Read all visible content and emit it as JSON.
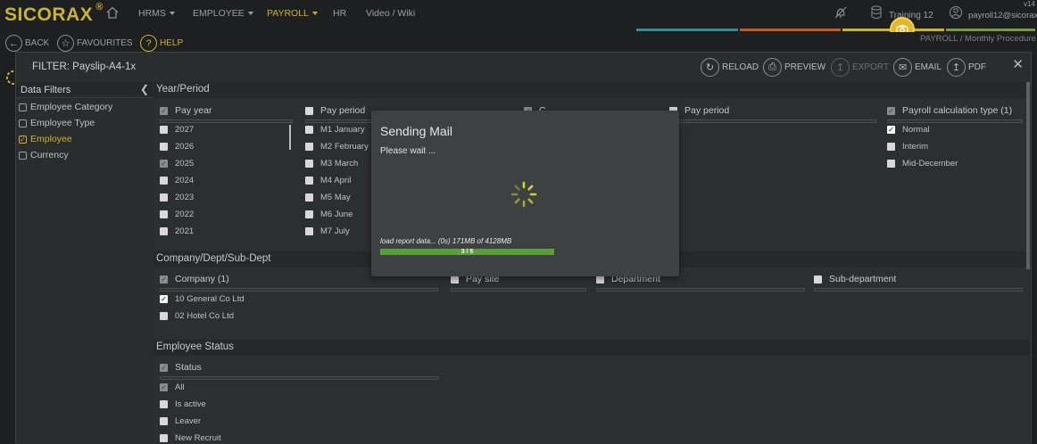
{
  "app": {
    "logo": "SICORAX",
    "logo_mark": "®",
    "version": "v14"
  },
  "topnav": {
    "items": [
      {
        "label": "HRMS",
        "dropdown": true
      },
      {
        "label": "EMPLOYEE",
        "dropdown": true
      },
      {
        "label": "PAYROLL",
        "dropdown": true,
        "active": true
      },
      {
        "label": "HR",
        "dropdown": false
      },
      {
        "label": "Video / Wiki",
        "dropdown": false
      }
    ],
    "db_label": "Training 12",
    "user": "payroll12@sicorax"
  },
  "breadcrumb": {
    "section": "PAYROLL",
    "sep": "/",
    "page": "Monthly Procedure"
  },
  "secondbar": {
    "back": "BACK",
    "favourites": "FAVOURITES",
    "help": "HELP"
  },
  "panel": {
    "title": "FILTER: Payslip-A4-1x",
    "toolbar": {
      "reload": "RELOAD",
      "preview": "PREVIEW",
      "export": "EXPORT",
      "email": "EMAIL",
      "pdf": "PDF"
    },
    "close": "✕"
  },
  "left": {
    "header": "Data Filters",
    "collapse": "❮",
    "items": [
      {
        "label": "Employee Category",
        "checked": false
      },
      {
        "label": "Employee Type",
        "checked": false
      },
      {
        "label": "Employee",
        "checked": true
      },
      {
        "label": "Currency",
        "checked": false
      }
    ]
  },
  "sections": {
    "year_period": "Year/Period",
    "company": "Company/Dept/Sub-Dept",
    "status": "Employee Status"
  },
  "pay_year": {
    "header": "Pay year",
    "items": [
      "2027",
      "2026",
      "2025",
      "2024",
      "2023",
      "2022",
      "2021"
    ],
    "checked": [
      false,
      false,
      true,
      false,
      false,
      false,
      false
    ]
  },
  "pay_period": {
    "header": "Pay period",
    "items": [
      "M1 January",
      "M2 February",
      "M3 March",
      "M4 April",
      "M5 May",
      "M6 June",
      "M7 July"
    ]
  },
  "pay_period2": {
    "header": "Pay period"
  },
  "col3_header": "C",
  "payroll_calc": {
    "header": "Payroll calculation type (1)",
    "items": [
      "Normal",
      "Interim",
      "Mid-December"
    ],
    "checked": [
      true,
      false,
      false
    ]
  },
  "company": {
    "header": "Company (1)",
    "items": [
      "10 General Co Ltd",
      "02 Hotel Co Ltd"
    ],
    "checked": [
      true,
      false
    ],
    "paysite": "Pay site",
    "department": "Department",
    "subdept": "Sub-department"
  },
  "status": {
    "header": "Status",
    "items": [
      "All",
      "Is active",
      "Leaver",
      "New Recruit"
    ]
  },
  "modal": {
    "title": "Sending Mail",
    "message": "Please wait ...",
    "progress_text": "load report data... (0s) 171MB of 4128MB",
    "progress_label": "3 / 5",
    "progress_value": 0.6
  },
  "colors": {
    "accent": "#c9b42e",
    "progress": "#5b9e3c",
    "avatar": "#e5b82a"
  }
}
